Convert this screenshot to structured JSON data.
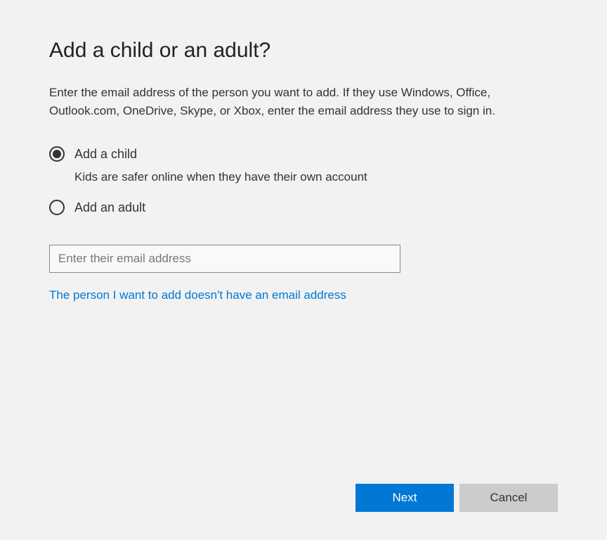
{
  "title": "Add a child or an adult?",
  "description": "Enter the email address of the person you want to add. If they use Windows, Office, Outlook.com, OneDrive, Skype, or Xbox, enter the email address they use to sign in.",
  "options": {
    "child": {
      "label": "Add a child",
      "subtext": "Kids are safer online when they have their own account",
      "selected": true
    },
    "adult": {
      "label": "Add an adult",
      "selected": false
    }
  },
  "email": {
    "placeholder": "Enter their email address",
    "value": ""
  },
  "link": {
    "no_email": "The person I want to add doesn't have an email address"
  },
  "buttons": {
    "next": "Next",
    "cancel": "Cancel"
  }
}
